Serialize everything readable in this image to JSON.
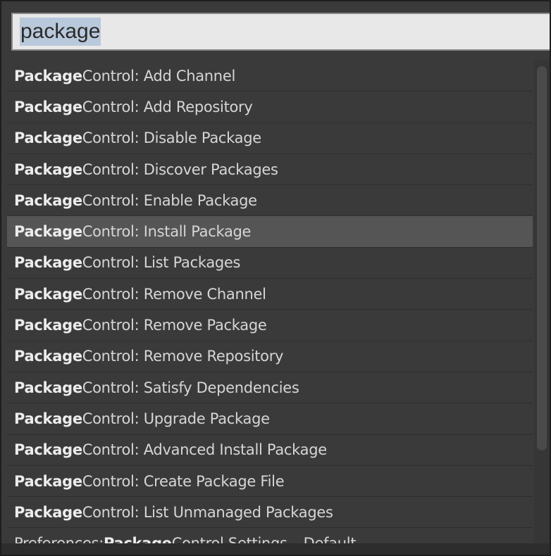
{
  "search": {
    "value": "package"
  },
  "results": [
    {
      "match": "Package",
      "rest": " Control: Add Channel"
    },
    {
      "match": "Package",
      "rest": " Control: Add Repository"
    },
    {
      "match": "Package",
      "rest": " Control: Disable Package"
    },
    {
      "match": "Package",
      "rest": " Control: Discover Packages"
    },
    {
      "match": "Package",
      "rest": " Control: Enable Package"
    },
    {
      "match": "Package",
      "rest": " Control: Install Package",
      "selected": true
    },
    {
      "match": "Package",
      "rest": " Control: List Packages"
    },
    {
      "match": "Package",
      "rest": " Control: Remove Channel"
    },
    {
      "match": "Package",
      "rest": " Control: Remove Package"
    },
    {
      "match": "Package",
      "rest": " Control: Remove Repository"
    },
    {
      "match": "Package",
      "rest": " Control: Satisfy Dependencies"
    },
    {
      "match": "Package",
      "rest": " Control: Upgrade Package"
    },
    {
      "match": "Package",
      "rest": " Control: Advanced Install Package"
    },
    {
      "match": "Package",
      "rest": " Control: Create Package File"
    },
    {
      "match": "Package",
      "rest": " Control: List Unmanaged Packages"
    },
    {
      "prefix": "Preferences: ",
      "match": "Package",
      "rest": " Control Settings – Default"
    }
  ],
  "colors": {
    "background": "#3a3a3a",
    "selected_row": "#555555",
    "input_bg": "#e8e8e8",
    "input_selection": "#b9c9dc"
  }
}
